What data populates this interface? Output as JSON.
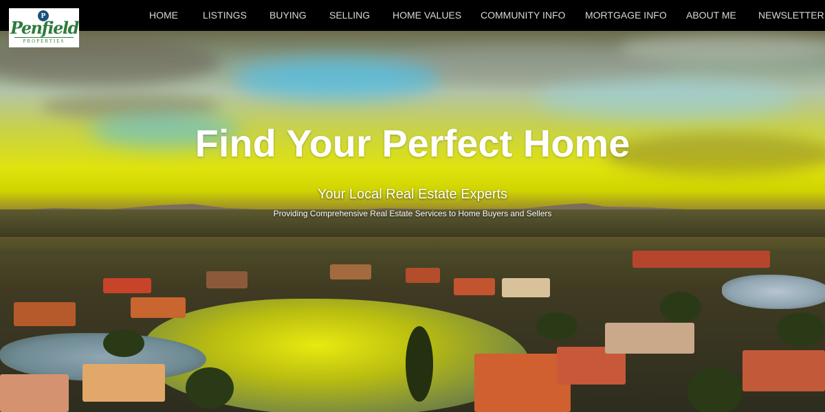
{
  "brand": {
    "logo_monogram": "P",
    "logo_name": "Penfield",
    "logo_sub": "PROPERTIES"
  },
  "nav": {
    "items": [
      {
        "label": "HOME"
      },
      {
        "label": "LISTINGS"
      },
      {
        "label": "BUYING"
      },
      {
        "label": "SELLING"
      },
      {
        "label": "HOME VALUES"
      },
      {
        "label": "COMMUNITY INFO"
      },
      {
        "label": "MORTGAGE INFO"
      },
      {
        "label": "ABOUT ME"
      },
      {
        "label": "NEWSLETTER"
      }
    ]
  },
  "hero": {
    "title": "Find Your Perfect Home",
    "subtitle": "Your Local Real Estate Experts",
    "description": "Providing Comprehensive Real Estate Services to Home Buyers and Sellers"
  },
  "colors": {
    "nav_bg": "#000000",
    "nav_text": "#d9d9d9",
    "logo_green": "#2f7b3c",
    "hero_text": "#ffffff"
  }
}
